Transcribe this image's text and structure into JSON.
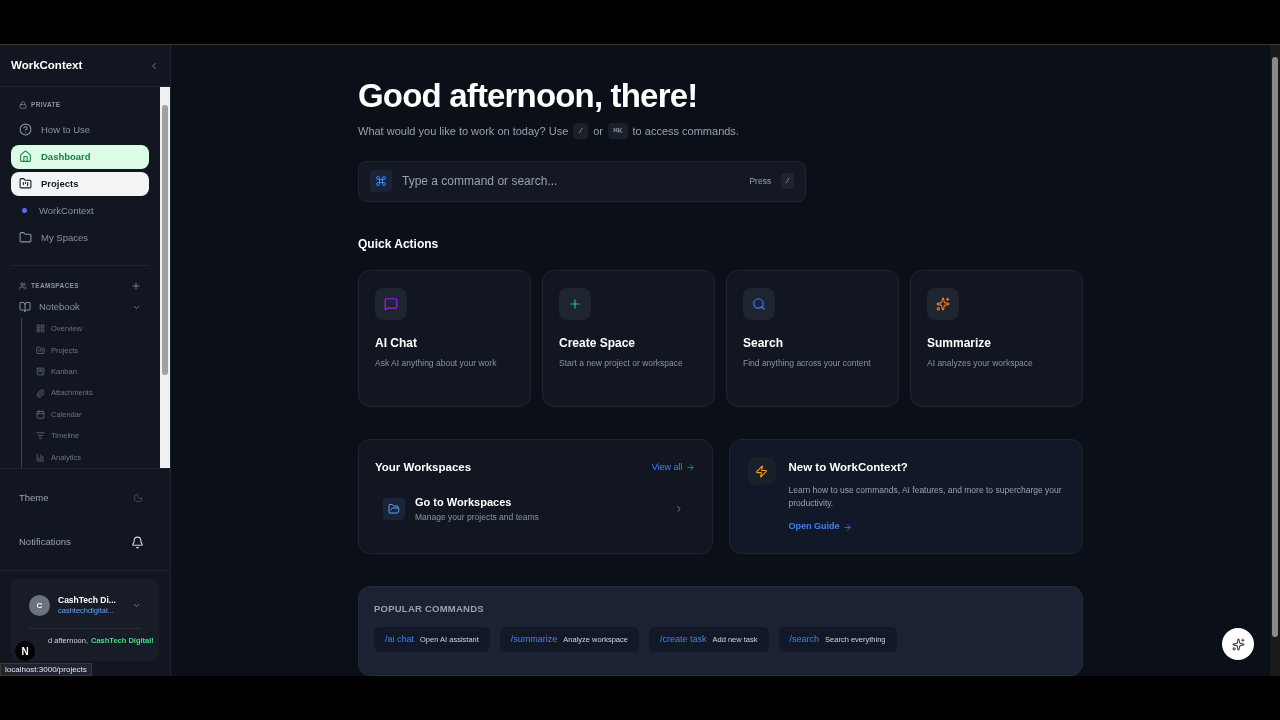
{
  "sidebar": {
    "brand": "WorkContext",
    "private": {
      "heading": "PRIVATE",
      "items": [
        {
          "kind": "help",
          "label": "How to Use",
          "selected": false,
          "hovered": false
        },
        {
          "kind": "home",
          "label": "Dashboard",
          "selected": true,
          "hovered": false
        },
        {
          "kind": "projects",
          "label": "Projects",
          "selected": false,
          "hovered": true
        },
        {
          "kind": "dot",
          "label": "WorkContext",
          "selected": false,
          "hovered": false
        },
        {
          "kind": "folder",
          "label": "My Spaces",
          "selected": false,
          "hovered": false
        }
      ]
    },
    "teamspaces": {
      "heading": "TEAMSPACES",
      "notebook": {
        "label": "Notebook",
        "expanded": true,
        "children": [
          {
            "kind": "overview",
            "label": "Overview"
          },
          {
            "kind": "projects",
            "label": "Projects"
          },
          {
            "kind": "kanban",
            "label": "Kanban"
          },
          {
            "kind": "attachments",
            "label": "Attachments"
          },
          {
            "kind": "calendar",
            "label": "Calendar"
          },
          {
            "kind": "timeline",
            "label": "Timeline"
          },
          {
            "kind": "analytics",
            "label": "Analytics"
          }
        ]
      }
    },
    "theme": "Theme",
    "notifications": "Notifications",
    "user": {
      "name": "CashTech Di...",
      "email": "cashtechdigital...",
      "initial": "C",
      "greeting": "d afternoon,",
      "greeting_name": "CashTech Digital!"
    },
    "dev_badge": "N",
    "status_url": "localhost:3000/projects"
  },
  "main": {
    "title": "Good afternoon, there!",
    "subtitle": [
      "What would you like to work on today? Use",
      "/",
      "or",
      "⌘K",
      "to access commands."
    ],
    "command": {
      "placeholder": "Type a command or search...",
      "hint": "Press",
      "key": "/"
    },
    "quick_actions": {
      "heading": "Quick Actions",
      "cards": [
        {
          "kind": "chat",
          "title": "AI Chat",
          "description": "Ask AI anything about your work"
        },
        {
          "kind": "create",
          "title": "Create Space",
          "description": "Start a new project or workspace"
        },
        {
          "kind": "search",
          "title": "Search",
          "description": "Find anything across your content"
        },
        {
          "kind": "summarize",
          "title": "Summarize",
          "description": "AI analyzes your workspace"
        }
      ]
    },
    "workspaces": {
      "heading": "Your Workspaces",
      "link": "View all",
      "item": {
        "title": "Go to Workspaces",
        "description": "Manage your projects and teams"
      }
    },
    "guide": {
      "title": "New to WorkContext?",
      "description": "Learn how to use commands, AI features, and more to supercharge your productivity.",
      "link": "Open Guide"
    },
    "popular": {
      "heading": "POPULAR COMMANDS",
      "commands": [
        {
          "command": "/ai chat",
          "description": "Open AI assistant"
        },
        {
          "command": "/summarize",
          "description": "Analyze workspace"
        },
        {
          "command": "/create task",
          "description": "Add new task"
        },
        {
          "command": "/search",
          "description": "Search everything"
        }
      ]
    }
  }
}
